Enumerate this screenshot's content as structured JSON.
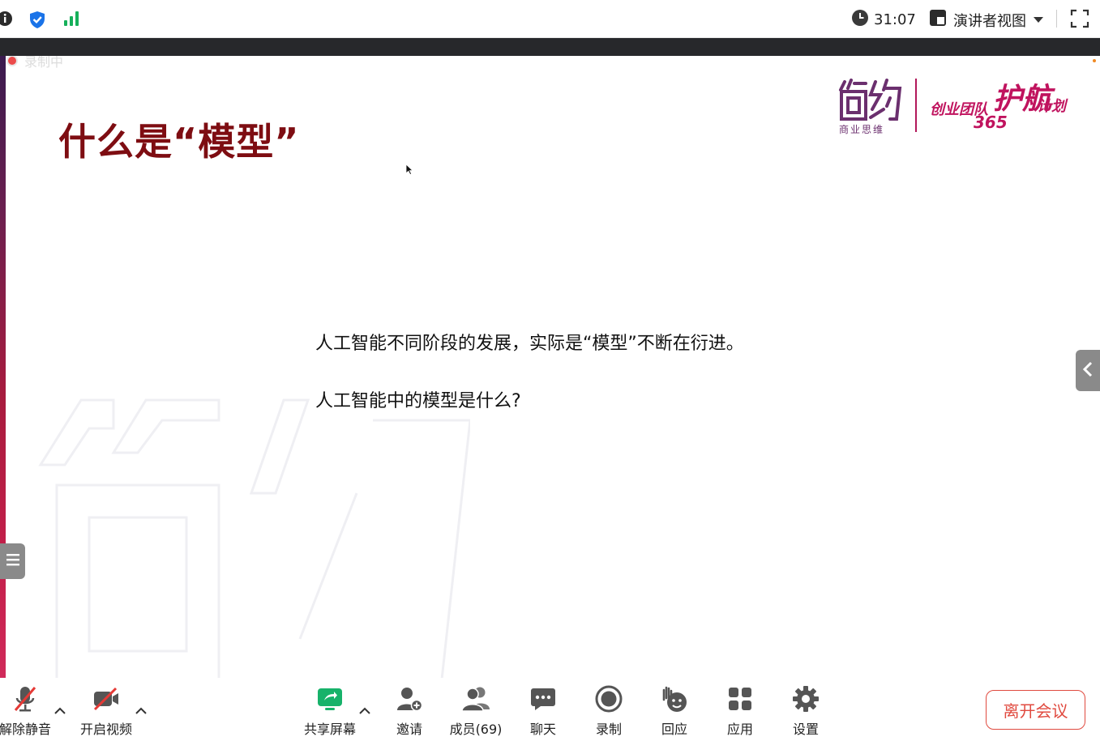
{
  "topbar": {
    "timer": "31:07",
    "view_mode": "演讲者视图"
  },
  "recording": {
    "label": "录制中"
  },
  "slide": {
    "title": "什么是“模型”",
    "line1": "人工智能不同阶段的发展，实际是“模型”不断在衍进。",
    "line2": "人工智能中的模型是什么?",
    "logo": {
      "brand": "简约",
      "sub": "商业思维",
      "tag_a": "创业团队",
      "tag_b": "护航",
      "tag_c": "计划",
      "tag_num": "365"
    }
  },
  "toolbar": {
    "unmute": "解除静音",
    "start_video": "开启视频",
    "share_screen": "共享屏幕",
    "invite": "邀请",
    "participants": "成员(69)",
    "chat": "聊天",
    "record": "录制",
    "reactions": "回应",
    "apps": "应用",
    "settings": "设置",
    "leave": "离开会议"
  },
  "colors": {
    "title": "#7e0d12",
    "brand": "#c0135e",
    "leave": "#e04a3f",
    "share_green": "#17b26a"
  }
}
